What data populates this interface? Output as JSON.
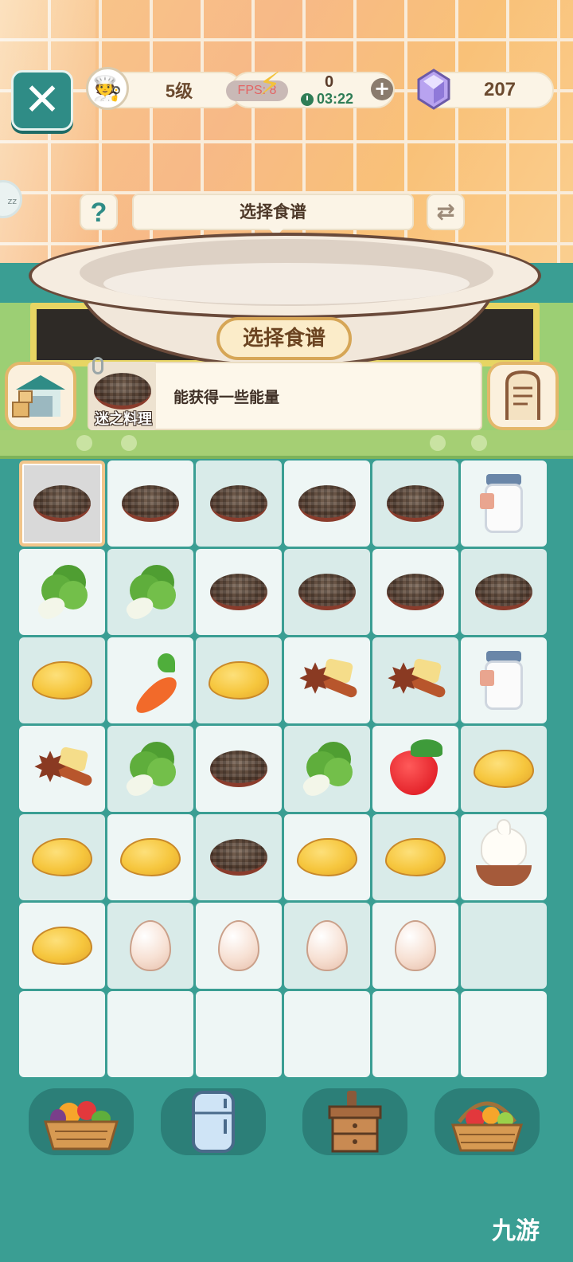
{
  "header": {
    "level": "5级",
    "fps": "FPS: 8",
    "energy": "0",
    "timer": "03:22",
    "gems": "207"
  },
  "recipe": {
    "hint_label": "选择食谱",
    "button_label": "选择食谱",
    "help": "?"
  },
  "info": {
    "dish_name": "迷之料理",
    "description": "能获得一些能量"
  },
  "side_bubble": "zz",
  "board": {
    "rows": [
      [
        "dish",
        "dish",
        "dish",
        "dish",
        "dish",
        "milk"
      ],
      [
        "cabbage",
        "cabbage",
        "dish",
        "dish",
        "dish",
        "dish"
      ],
      [
        "potato",
        "carrot",
        "potato",
        "spice",
        "spice",
        "milk"
      ],
      [
        "spice",
        "cabbage",
        "dish",
        "cabbage",
        "strawberry",
        "potato"
      ],
      [
        "potato",
        "potato",
        "dish",
        "potato",
        "potato",
        "cream"
      ],
      [
        "potato",
        "egg",
        "egg",
        "egg",
        "egg",
        ""
      ],
      [
        "",
        "",
        "",
        "",
        "",
        ""
      ]
    ],
    "selected": [
      0,
      0
    ]
  },
  "toolbar": {
    "items": [
      "vegetable-basket",
      "fridge",
      "cabinet",
      "fruit-basket"
    ]
  },
  "watermark": "九游",
  "colors": {
    "background": "#3a9e93",
    "accent": "#2f8c86",
    "cell_light": "#eef6f5",
    "cell_dark": "#d9ebe9"
  }
}
